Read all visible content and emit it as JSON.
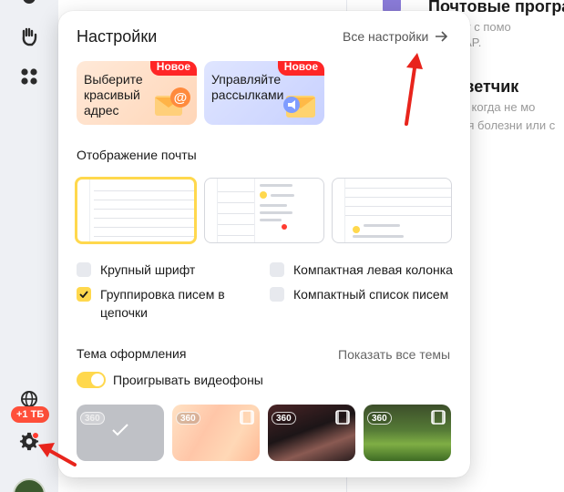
{
  "sidebar": {
    "storage_badge": "+1 ТБ"
  },
  "background": {
    "item1_title": "Почтовые програ",
    "item1_desc_line1": "к ящику с помо",
    "item1_desc_line2": "олу IMAP.",
    "item2_title": "ответчик",
    "item2_desc_line1": "ите, когда не мо",
    "item2_desc_line2": "ремя болезни или с"
  },
  "settings": {
    "title": "Настройки",
    "all_settings_label": "Все настройки",
    "promos": [
      {
        "text": "Выберите красивый адрес",
        "badge": "Новое"
      },
      {
        "text": "Управляйте рассылками",
        "badge": "Новое"
      }
    ],
    "mail_display_label": "Отображение почты",
    "options": {
      "large_font": "Крупный шрифт",
      "compact_left_column": "Компактная левая колонка",
      "group_threads": "Группировка писем в цепочки",
      "compact_list": "Компактный список писем"
    },
    "theme_label": "Тема оформления",
    "show_all_themes": "Показать все темы",
    "video_toggle_label": "Проигрывать видеофоны",
    "theme_badge": "360"
  },
  "colors": {
    "accent_yellow": "#ffd84d",
    "badge_red": "#ff2626",
    "annotation_arrow": "#e8241c"
  }
}
